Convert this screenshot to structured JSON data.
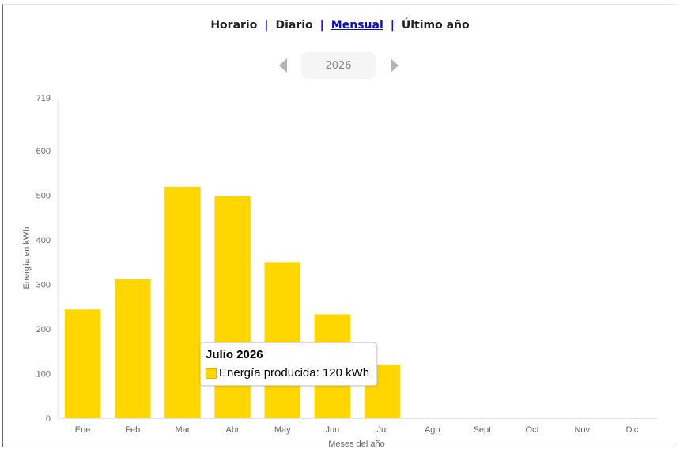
{
  "nav": {
    "items": [
      {
        "label": "Horario",
        "active": false
      },
      {
        "label": "Diario",
        "active": false
      },
      {
        "label": "Mensual",
        "active": true
      },
      {
        "label": "Último año",
        "active": false
      }
    ],
    "separator": "|"
  },
  "year_selector": {
    "value": "2026"
  },
  "tooltip": {
    "title": "Julio 2026",
    "label": "Energía producida: 120 kWh"
  },
  "colors": {
    "bar": "#ffd600",
    "accent": "#0b0bd6"
  },
  "chart_data": {
    "type": "bar",
    "categories": [
      "Ene",
      "Feb",
      "Mar",
      "Abr",
      "May",
      "Jun",
      "Jul",
      "Ago",
      "Sept",
      "Oct",
      "Nov",
      "Dic"
    ],
    "values": [
      244,
      312,
      519,
      498,
      350,
      233,
      120,
      0,
      0,
      0,
      0,
      0
    ],
    "xlabel": "Meses del año",
    "ylabel": "Energía en kWh",
    "ylim": [
      0,
      719
    ],
    "yticks": [
      0,
      100,
      200,
      300,
      400,
      500,
      600,
      719
    ],
    "grid": false
  }
}
